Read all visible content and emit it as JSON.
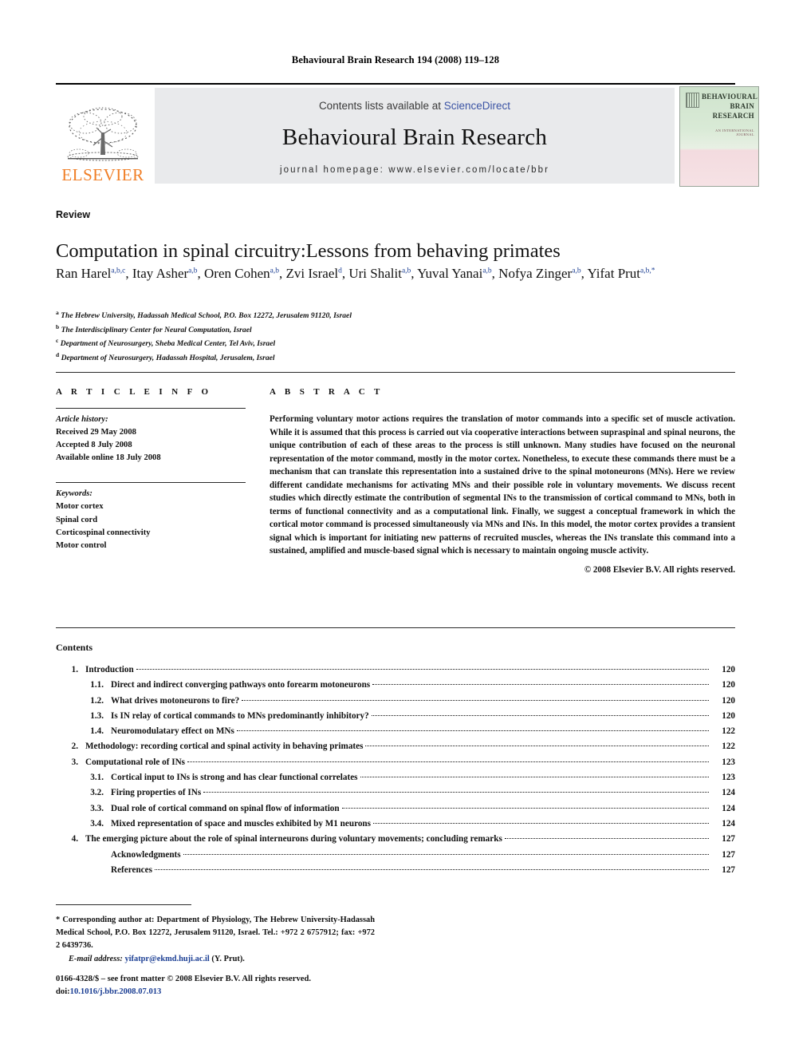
{
  "running_head": "Behavioural Brain Research 194 (2008) 119–128",
  "masthead": {
    "contents_prefix": "Contents lists available at ",
    "sciencedirect": "ScienceDirect",
    "journal_title": "Behavioural Brain Research",
    "homepage": "journal homepage: www.elsevier.com/locate/bbr",
    "publisher": "ELSEVIER",
    "cover": {
      "line1": "BEHAVIOURAL",
      "line2": "BRAIN",
      "line3": "RESEARCH",
      "subtitle": "AN INTERNATIONAL JOURNAL"
    }
  },
  "article": {
    "doctype": "Review",
    "title": "Computation in spinal circuitry:Lessons from behaving primates",
    "authors": [
      {
        "name": "Ran Harel",
        "sup": "a,b,c",
        "sep": ", "
      },
      {
        "name": "Itay Asher",
        "sup": "a,b",
        "sep": ", "
      },
      {
        "name": "Oren Cohen",
        "sup": "a,b",
        "sep": ", "
      },
      {
        "name": "Zvi Israel",
        "sup": "d",
        "sep": ", "
      },
      {
        "name": "Uri Shalit",
        "sup": "a,b",
        "sep": ", "
      },
      {
        "name": "Yuval Yanai",
        "sup": "a,b",
        "sep": ", "
      },
      {
        "name": "Nofya Zinger",
        "sup": "a,b",
        "sep": ", "
      },
      {
        "name": "Yifat Prut",
        "sup": "a,b,*",
        "sep": ""
      }
    ],
    "affiliations": [
      {
        "mark": "a",
        "text": "The Hebrew University, Hadassah Medical School, P.O. Box 12272, Jerusalem 91120, Israel"
      },
      {
        "mark": "b",
        "text": "The Interdisciplinary Center for Neural Computation, Israel"
      },
      {
        "mark": "c",
        "text": "Department of Neurosurgery, Sheba Medical Center, Tel Aviv, Israel"
      },
      {
        "mark": "d",
        "text": "Department of Neurosurgery, Hadassah Hospital, Jerusalem, Israel"
      }
    ]
  },
  "article_info": {
    "heading": "A R T I C L E   I N F O",
    "history_label": "Article history:",
    "history": [
      "Received 29 May 2008",
      "Accepted 8 July 2008",
      "Available online 18 July 2008"
    ],
    "keywords_label": "Keywords:",
    "keywords": [
      "Motor cortex",
      "Spinal cord",
      "Corticospinal connectivity",
      "Motor control"
    ]
  },
  "abstract": {
    "heading": "A B S T R A C T",
    "text": "Performing voluntary motor actions requires the translation of motor commands into a specific set of muscle activation. While it is assumed that this process is carried out via cooperative interactions between supraspinal and spinal neurons, the unique contribution of each of these areas to the process is still unknown. Many studies have focused on the neuronal representation of the motor command, mostly in the motor cortex. Nonetheless, to execute these commands there must be a mechanism that can translate this representation into a sustained drive to the spinal motoneurons (MNs). Here we review different candidate mechanisms for activating MNs and their possible role in voluntary movements. We discuss recent studies which directly estimate the contribution of segmental INs to the transmission of cortical command to MNs, both in terms of functional connectivity and as a computational link. Finally, we suggest a conceptual framework in which the cortical motor command is processed simultaneously via MNs and INs. In this model, the motor cortex provides a transient signal which is important for initiating new patterns of recruited muscles, whereas the INs translate this command into a sustained, amplified and muscle-based signal which is necessary to maintain ongoing muscle activity.",
    "copyright": "© 2008 Elsevier B.V. All rights reserved."
  },
  "contents": {
    "heading": "Contents",
    "rows": [
      {
        "num": "1.",
        "level": 0,
        "label": "Introduction",
        "page": "120"
      },
      {
        "num": "1.1.",
        "level": 1,
        "label": "Direct and indirect converging pathways onto forearm motoneurons",
        "page": "120"
      },
      {
        "num": "1.2.",
        "level": 1,
        "label": "What drives motoneurons to fire?",
        "page": "120"
      },
      {
        "num": "1.3.",
        "level": 1,
        "label": "Is IN relay of cortical commands to MNs predominantly inhibitory?",
        "page": "120"
      },
      {
        "num": "1.4.",
        "level": 1,
        "label": "Neuromodulatary effect on MNs",
        "page": "122"
      },
      {
        "num": "2.",
        "level": 0,
        "label": "Methodology: recording cortical and spinal activity in behaving primates",
        "page": "122"
      },
      {
        "num": "3.",
        "level": 0,
        "label": "Computational role of INs",
        "page": "123"
      },
      {
        "num": "3.1.",
        "level": 1,
        "label": "Cortical input to INs is strong and has clear functional correlates",
        "page": "123"
      },
      {
        "num": "3.2.",
        "level": 1,
        "label": "Firing properties of INs",
        "page": "124"
      },
      {
        "num": "3.3.",
        "level": 1,
        "label": "Dual role of cortical command on spinal flow of information",
        "page": "124"
      },
      {
        "num": "3.4.",
        "level": 1,
        "label": "Mixed representation of space and muscles exhibited by M1 neurons",
        "page": "124"
      },
      {
        "num": "4.",
        "level": 0,
        "label": "The emerging picture about the role of spinal interneurons during voluntary movements; concluding remarks",
        "page": "127"
      },
      {
        "num": "",
        "level": 2,
        "label": "Acknowledgments",
        "page": "127"
      },
      {
        "num": "",
        "level": 2,
        "label": "References",
        "page": "127"
      }
    ]
  },
  "footer": {
    "corresponding": "* Corresponding author at: Department of Physiology, The Hebrew University-Hadassah Medical School, P.O. Box 12272, Jerusalem 91120, Israel. Tel.: +972 2 6757912; fax: +972 2 6439736.",
    "email_label": "E-mail address:",
    "email": "yifatpr@ekmd.huji.ac.il",
    "email_suffix": "(Y. Prut).",
    "issn_line": "0166-4328/$ – see front matter © 2008 Elsevier B.V. All rights reserved.",
    "doi_label": "doi:",
    "doi": "10.1016/j.bbr.2008.07.013"
  },
  "colors": {
    "elsevier_orange": "#F07E26",
    "link_blue": "#1c3f94",
    "sciencedirect_blue": "#3a53a4",
    "masthead_grey": "#e9eaec"
  }
}
